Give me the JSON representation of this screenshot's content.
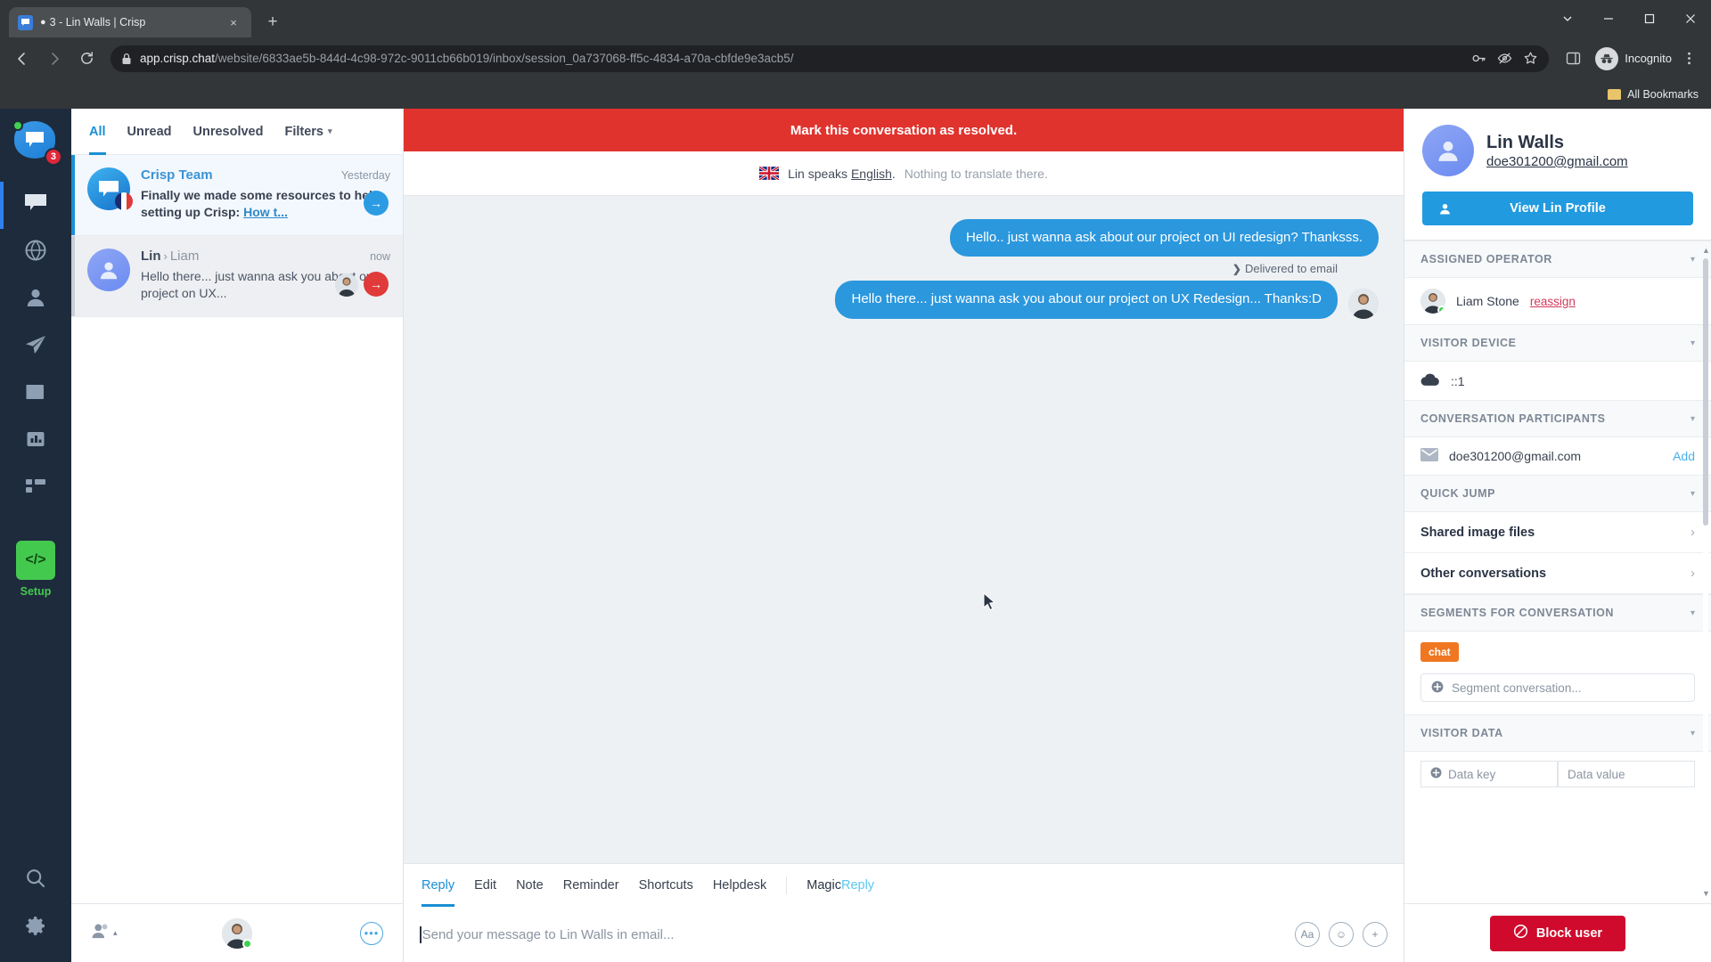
{
  "browser": {
    "tab": {
      "title": "3 - Lin Walls | Crisp",
      "favicon_icon": "crisp-chat-favicon",
      "bubble_glyph": "●"
    },
    "new_tab_label": "+",
    "close_label": "×",
    "window_controls": [
      "minimize-restore-caret",
      "minimize",
      "maximize",
      "close"
    ],
    "nav": {
      "back_icon": "back-arrow-icon",
      "forward_icon": "forward-arrow-icon",
      "reload_icon": "reload-icon"
    },
    "omnibox": {
      "lock_icon": "lock-icon",
      "url_domain": "app.crisp.chat",
      "url_path": "/website/6833ae5b-844d-4c98-972c-9011cb66b019/inbox/session_0a737068-ff5c-4834-a70a-cbfde9e3acb5/",
      "icons": [
        "password-key-icon",
        "eye-slash-icon",
        "bookmark-star-icon",
        "side-panel-icon"
      ]
    },
    "profile": {
      "label": "Incognito",
      "icon": "incognito-avatar-icon"
    },
    "menu_icon": "three-dot-menu-icon",
    "bookmarks": {
      "label": "All Bookmarks",
      "folder_icon": "folder-icon"
    }
  },
  "rail": {
    "badge": "3",
    "items": [
      {
        "name": "inbox",
        "icon": "chat-bubble-icon"
      },
      {
        "name": "visitors",
        "icon": "globe-icon"
      },
      {
        "name": "contacts",
        "icon": "user-icon"
      },
      {
        "name": "campaigns",
        "icon": "paper-plane-icon"
      },
      {
        "name": "helpdesk",
        "icon": "book-icon"
      },
      {
        "name": "analytics",
        "icon": "bar-chart-icon"
      },
      {
        "name": "plugins",
        "icon": "grid-icon"
      }
    ],
    "setup": {
      "label": "Setup",
      "icon": "code-brackets-icon"
    },
    "bottom": [
      {
        "name": "search",
        "icon": "magnifier-icon"
      },
      {
        "name": "settings",
        "icon": "gear-icon"
      }
    ]
  },
  "conversations": {
    "tabs": [
      {
        "label": "All",
        "active": true
      },
      {
        "label": "Unread",
        "active": false
      },
      {
        "label": "Unresolved",
        "active": false
      },
      {
        "label": "Filters",
        "active": false,
        "caret": "▾"
      }
    ],
    "items": [
      {
        "name": "Crisp Team",
        "time": "Yesterday",
        "preview_plain": "Finally we made some resources to help setting up Crisp: ",
        "preview_link": "How t...",
        "avatar": "crisp-logo-avatar",
        "flag": "france-flag",
        "action_icon": "arrow-right-icon"
      },
      {
        "name": "Lin",
        "arrow": "›",
        "to": "Liam",
        "time": "now",
        "preview_plain": "Hello there... just wanna ask you about our project on UX...",
        "preview_link": "",
        "avatar": "visitor-avatar",
        "action_icon": "arrow-right-icon"
      }
    ],
    "footer": {
      "availability_icon": "operator-availability-icon",
      "availability_caret": "▴",
      "operator_avatar": "operator-avatar",
      "more_label": "•••"
    }
  },
  "conversation": {
    "resolve_banner": "Mark this conversation as resolved.",
    "translate": {
      "flag": "uk-flag",
      "text_main": "Lin speaks ",
      "language": "English",
      "text_period": ".",
      "text_muted": "Nothing to translate there."
    },
    "messages": [
      {
        "text": "Hello.. just wanna ask about our project on UI redesign? Thanksss.",
        "from": "operator",
        "avatar": false
      },
      {
        "text": "Hello there... just wanna ask you about our project on UX Redesign... Thanks:D",
        "from": "operator",
        "avatar": true
      }
    ],
    "delivery_status": {
      "chevron": "❯",
      "label": "Delivered to email"
    }
  },
  "composer": {
    "tabs": [
      {
        "label": "Reply",
        "active": true
      },
      {
        "label": "Edit",
        "active": false
      },
      {
        "label": "Note",
        "active": false
      },
      {
        "label": "Reminder",
        "active": false
      },
      {
        "label": "Shortcuts",
        "active": false
      },
      {
        "label": "Helpdesk",
        "active": false
      }
    ],
    "magic_tab": {
      "part1": "Magic",
      "part2": "Reply"
    },
    "placeholder": "Send your message to Lin Walls in email...",
    "value": "",
    "tools": [
      {
        "name": "text-format-button",
        "glyph": "Aa"
      },
      {
        "name": "emoji-button",
        "glyph": "☺"
      },
      {
        "name": "attachment-add-button",
        "glyph": "+"
      }
    ],
    "more_button": "•••"
  },
  "right_panel": {
    "visitor": {
      "name": "Lin Walls",
      "email": "doe301200@gmail.com",
      "avatar_icon": "visitor-avatar-icon"
    },
    "profile_button": {
      "label": "View Lin Profile",
      "icon": "user-icon"
    },
    "sections": {
      "assigned_operator": {
        "title": "ASSIGNED OPERATOR",
        "operator_name": "Liam Stone",
        "reassign_label": "reassign",
        "caret": "▾"
      },
      "visitor_device": {
        "title": "VISITOR DEVICE",
        "icon": "cloud-icon",
        "value": "::1",
        "caret": "▾"
      },
      "conversation_participants": {
        "title": "CONVERSATION PARTICIPANTS",
        "icon": "envelope-icon",
        "email": "doe301200@gmail.com",
        "add_label": "Add",
        "caret": "▾"
      },
      "quick_jump": {
        "title": "QUICK JUMP",
        "caret": "▾",
        "items": [
          {
            "label": "Shared image files",
            "chevron": "›"
          },
          {
            "label": "Other conversations",
            "chevron": "›"
          }
        ]
      },
      "segments": {
        "title": "SEGMENTS FOR CONVERSATION",
        "caret": "▾",
        "chips": [
          "chat"
        ],
        "input_placeholder": "Segment conversation...",
        "plus_icon": "plus-circle-icon"
      },
      "visitor_data": {
        "title": "VISITOR DATA",
        "caret": "▾",
        "key_placeholder": "Data key",
        "value_placeholder": "Data value",
        "plus_icon": "plus-circle-icon"
      }
    },
    "block_button": {
      "label": "Block user",
      "icon": "block-circle-icon"
    }
  },
  "colors": {
    "crisp_blue": "#2b97dd",
    "danger_red": "#e0332e",
    "block_red": "#cf0a2c",
    "segment_orange": "#ef7722",
    "setup_green": "#44c94f",
    "rail_dark": "#1e2b3c"
  }
}
